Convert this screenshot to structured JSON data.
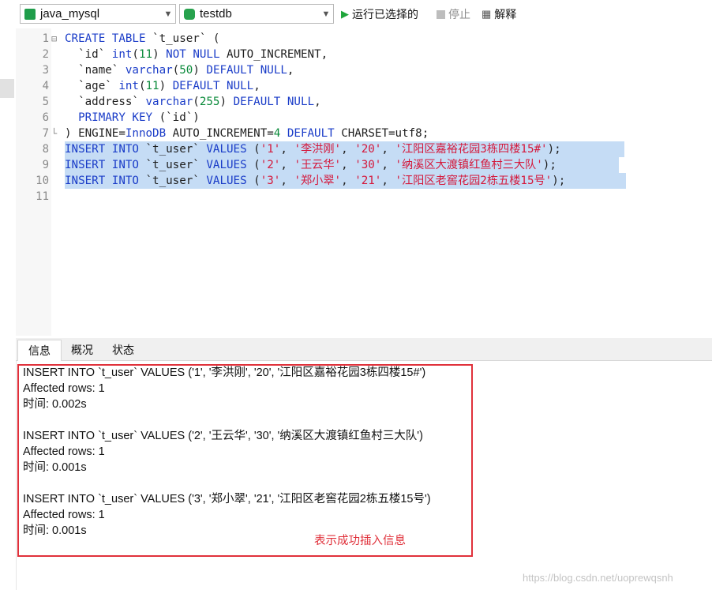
{
  "toolbar": {
    "connection": "java_mysql",
    "database": "testdb",
    "run_selected": "运行已选择的",
    "stop": "停止",
    "explain": "解释"
  },
  "editor": {
    "line_numbers": [
      "1",
      "2",
      "3",
      "4",
      "5",
      "6",
      "7",
      "8",
      "9",
      "10",
      "11"
    ],
    "lines": [
      [
        {
          "t": "CREATE TABLE ",
          "c": "kw"
        },
        {
          "t": "`t_user` (",
          "c": "plain"
        }
      ],
      [
        {
          "t": "  `id` ",
          "c": "plain"
        },
        {
          "t": "int",
          "c": "kw"
        },
        {
          "t": "(",
          "c": "plain"
        },
        {
          "t": "11",
          "c": "num"
        },
        {
          "t": ") ",
          "c": "plain"
        },
        {
          "t": "NOT NULL ",
          "c": "kw"
        },
        {
          "t": "AUTO_INCREMENT,",
          "c": "plain"
        }
      ],
      [
        {
          "t": "  `name` ",
          "c": "plain"
        },
        {
          "t": "varchar",
          "c": "kw"
        },
        {
          "t": "(",
          "c": "plain"
        },
        {
          "t": "50",
          "c": "num"
        },
        {
          "t": ") ",
          "c": "plain"
        },
        {
          "t": "DEFAULT NULL",
          "c": "kw"
        },
        {
          "t": ",",
          "c": "plain"
        }
      ],
      [
        {
          "t": "  `age` ",
          "c": "plain"
        },
        {
          "t": "int",
          "c": "kw"
        },
        {
          "t": "(",
          "c": "plain"
        },
        {
          "t": "11",
          "c": "num"
        },
        {
          "t": ") ",
          "c": "plain"
        },
        {
          "t": "DEFAULT NULL",
          "c": "kw"
        },
        {
          "t": ",",
          "c": "plain"
        }
      ],
      [
        {
          "t": "  `address` ",
          "c": "plain"
        },
        {
          "t": "varchar",
          "c": "kw"
        },
        {
          "t": "(",
          "c": "plain"
        },
        {
          "t": "255",
          "c": "num"
        },
        {
          "t": ") ",
          "c": "plain"
        },
        {
          "t": "DEFAULT NULL",
          "c": "kw"
        },
        {
          "t": ",",
          "c": "plain"
        }
      ],
      [
        {
          "t": "  PRIMARY KEY ",
          "c": "kw"
        },
        {
          "t": "(`id`)",
          "c": "plain"
        }
      ],
      [
        {
          "t": ") ENGINE=",
          "c": "plain"
        },
        {
          "t": "InnoDB",
          "c": "kw"
        },
        {
          "t": " AUTO_INCREMENT=",
          "c": "plain"
        },
        {
          "t": "4",
          "c": "num"
        },
        {
          "t": " ",
          "c": "plain"
        },
        {
          "t": "DEFAULT",
          "c": "kw"
        },
        {
          "t": " CHARSET=utf8;",
          "c": "plain"
        }
      ],
      [
        {
          "t": "INSERT INTO ",
          "c": "kw"
        },
        {
          "t": "`t_user` ",
          "c": "plain"
        },
        {
          "t": "VALUES ",
          "c": "kw"
        },
        {
          "t": "(",
          "c": "plain"
        },
        {
          "t": "'1'",
          "c": "str"
        },
        {
          "t": ", ",
          "c": "plain"
        },
        {
          "t": "'李洪刚'",
          "c": "str"
        },
        {
          "t": ", ",
          "c": "plain"
        },
        {
          "t": "'20'",
          "c": "str"
        },
        {
          "t": ", ",
          "c": "plain"
        },
        {
          "t": "'江阳区嘉裕花园3栋四楼15#'",
          "c": "str"
        },
        {
          "t": ");",
          "c": "plain"
        }
      ],
      [
        {
          "t": "INSERT INTO ",
          "c": "kw"
        },
        {
          "t": "`t_user` ",
          "c": "plain"
        },
        {
          "t": "VALUES ",
          "c": "kw"
        },
        {
          "t": "(",
          "c": "plain"
        },
        {
          "t": "'2'",
          "c": "str"
        },
        {
          "t": ", ",
          "c": "plain"
        },
        {
          "t": "'王云华'",
          "c": "str"
        },
        {
          "t": ", ",
          "c": "plain"
        },
        {
          "t": "'30'",
          "c": "str"
        },
        {
          "t": ", ",
          "c": "plain"
        },
        {
          "t": "'纳溪区大渡镇红鱼村三大队'",
          "c": "str"
        },
        {
          "t": ");",
          "c": "plain"
        }
      ],
      [
        {
          "t": "INSERT INTO ",
          "c": "kw"
        },
        {
          "t": "`t_user` ",
          "c": "plain"
        },
        {
          "t": "VALUES ",
          "c": "kw"
        },
        {
          "t": "(",
          "c": "plain"
        },
        {
          "t": "'3'",
          "c": "str"
        },
        {
          "t": ", ",
          "c": "plain"
        },
        {
          "t": "'郑小翠'",
          "c": "str"
        },
        {
          "t": ", ",
          "c": "plain"
        },
        {
          "t": "'21'",
          "c": "str"
        },
        {
          "t": ", ",
          "c": "plain"
        },
        {
          "t": "'江阳区老窖花园2栋五楼15号'",
          "c": "str"
        },
        {
          "t": ");",
          "c": "plain"
        }
      ],
      []
    ]
  },
  "tabs": [
    "信息",
    "概况",
    "状态"
  ],
  "messages": [
    "INSERT INTO `t_user` VALUES ('1', '李洪刚', '20', '江阳区嘉裕花园3栋四楼15#')",
    "Affected rows: 1",
    "时间: 0.002s",
    "",
    "INSERT INTO `t_user` VALUES ('2', '王云华', '30', '纳溪区大渡镇红鱼村三大队')",
    "Affected rows: 1",
    "时间: 0.001s",
    "",
    "INSERT INTO `t_user` VALUES ('3', '郑小翠', '21', '江阳区老窖花园2栋五楼15号')",
    "Affected rows: 1",
    "时间: 0.001s"
  ],
  "annotation": "表示成功插入信息",
  "watermark": "https://blog.csdn.net/uoprewqsnh",
  "colors": {
    "keyword": "#1a3cc8",
    "number": "#0a8a3a",
    "string": "#d4193c",
    "highlight": "#c5dcf5",
    "annotation": "#e0313b"
  },
  "icons": [
    "connection-icon",
    "database-icon",
    "run-icon",
    "stop-icon",
    "explain-icon",
    "chevron-down-icon",
    "fold-icon"
  ]
}
